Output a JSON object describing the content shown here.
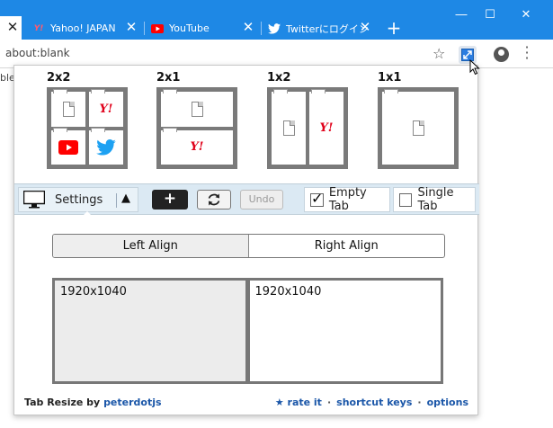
{
  "browser": {
    "tabs": [
      {
        "title": "",
        "active": true
      },
      {
        "title": "Yahoo! JAPAN",
        "favicon": "yahoo-icon"
      },
      {
        "title": "YouTube",
        "favicon": "youtube-icon"
      },
      {
        "title": "Twitterにログイン",
        "favicon": "twitter-icon"
      }
    ],
    "new_tab_label": "+",
    "address": "about:blank",
    "bookmark_fragment": "bleA",
    "colors": {
      "titlebar": "#1e88e5",
      "yahoo": "#e0001a",
      "youtube": "#ff0000",
      "twitter": "#1da1f2"
    }
  },
  "popup": {
    "layouts": [
      {
        "name": "2x2",
        "cells": [
          "blank",
          "yahoo",
          "youtube",
          "twitter"
        ]
      },
      {
        "name": "2x1",
        "cells": [
          "blank",
          "yahoo"
        ]
      },
      {
        "name": "1x2",
        "cells": [
          "blank",
          "yahoo"
        ]
      },
      {
        "name": "1x1",
        "cells": [
          "blank"
        ]
      }
    ],
    "yahoo_mark": "Y!",
    "controls": {
      "settings_label": "Settings",
      "add_label": "+",
      "undo_label": "Undo",
      "empty_tab_label": "Empty Tab",
      "empty_tab_checked": true,
      "single_tab_label": "Single Tab",
      "single_tab_checked": false
    },
    "align": {
      "left": "Left Align",
      "right": "Right Align",
      "selected": "left"
    },
    "displays": [
      {
        "resolution": "1920x1040"
      },
      {
        "resolution": "1920x1040"
      }
    ],
    "footer": {
      "app_name": "Tab Resize",
      "by": "by",
      "author": "peterdotjs",
      "rate": "★ rate it",
      "shortcut": "shortcut keys",
      "options": "options"
    }
  }
}
